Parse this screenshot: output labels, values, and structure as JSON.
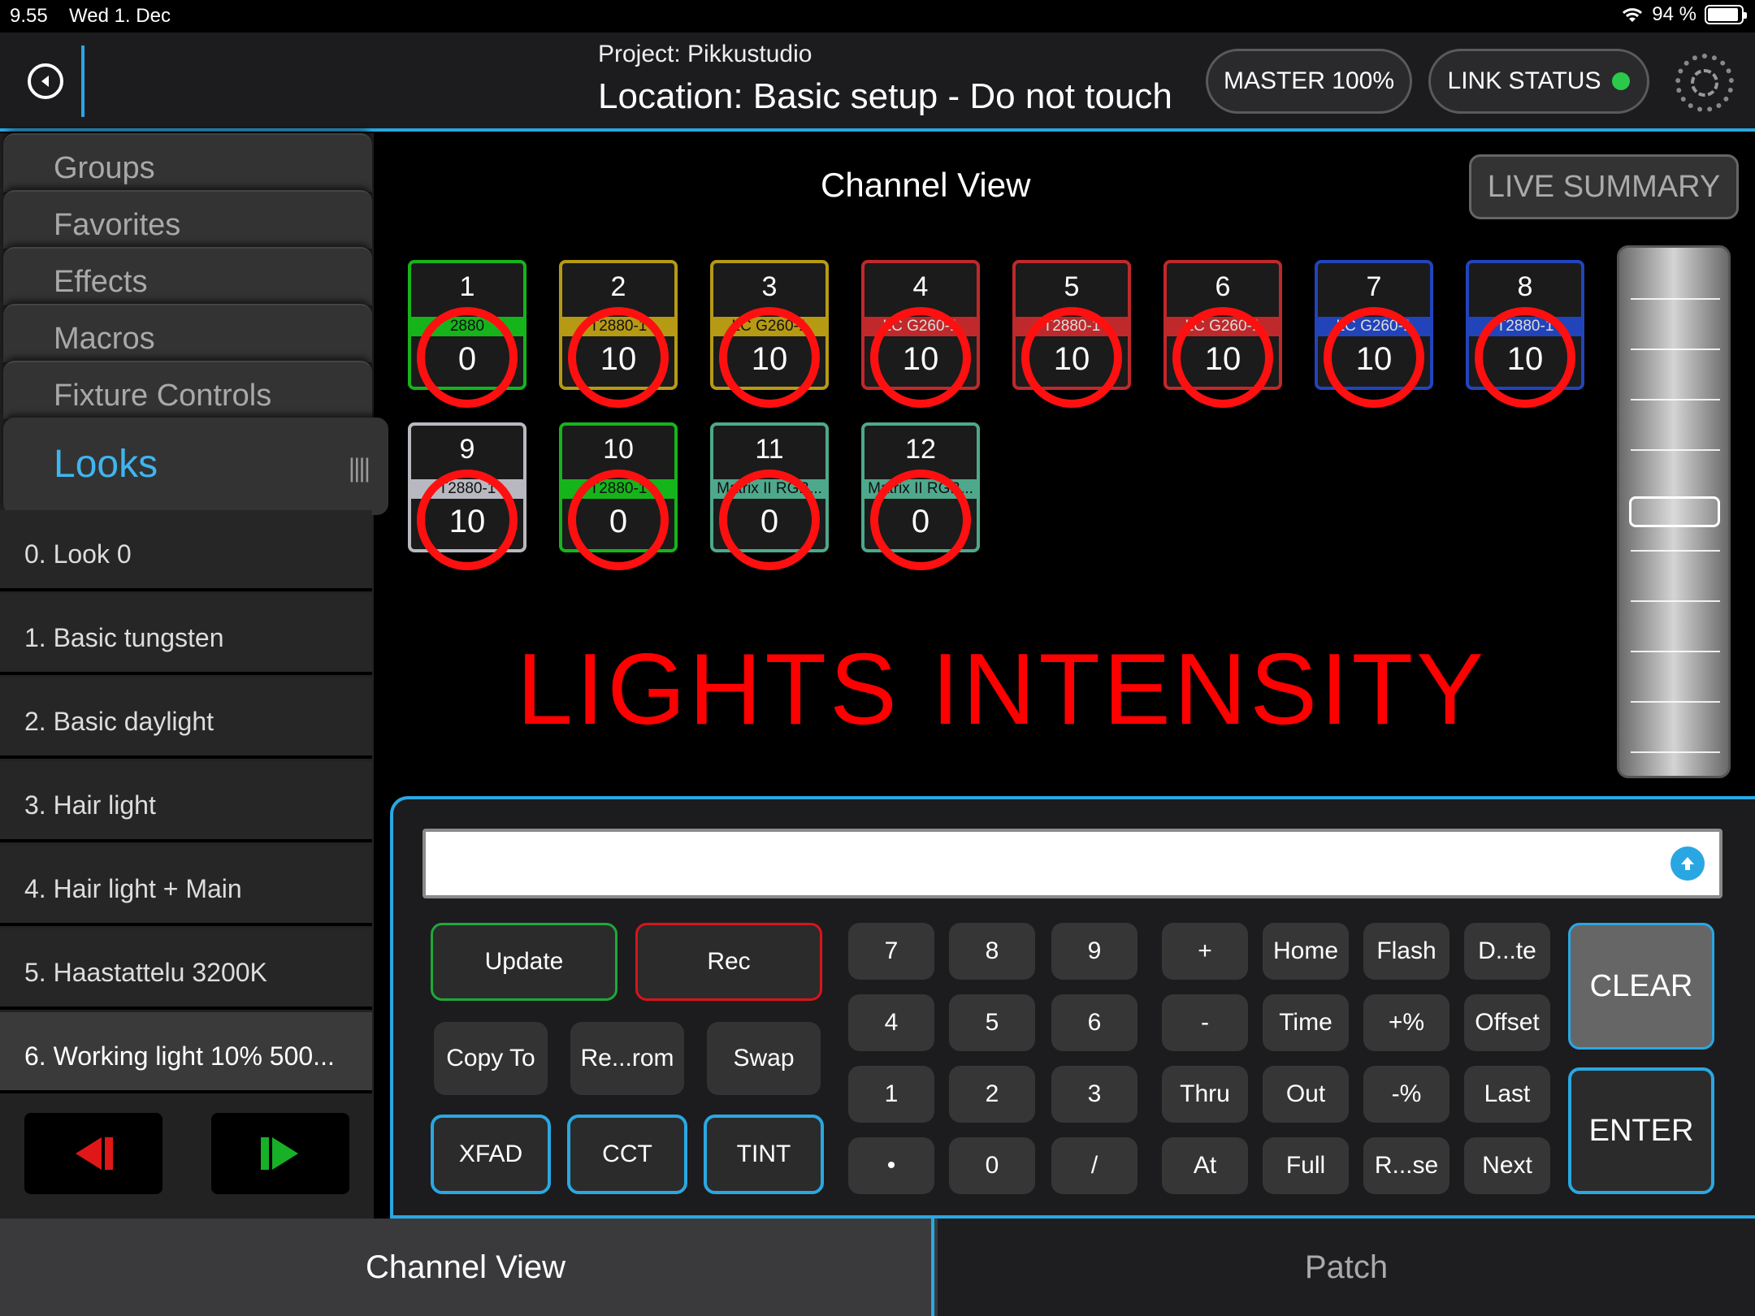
{
  "status": {
    "time": "9.55",
    "date": "Wed 1. Dec",
    "battery": "94 %"
  },
  "header": {
    "project": "Project: Pikkustudio",
    "location": "Location: Basic setup - Do not touch",
    "master": "MASTER 100%",
    "link_status": "LINK STATUS",
    "link_color": "#2bc94b"
  },
  "sidebar": {
    "tabs": [
      "Groups",
      "Favorites",
      "Effects",
      "Macros",
      "Fixture Controls"
    ],
    "active_tab": "Looks",
    "looks": [
      "0. Look 0",
      "1. Basic tungsten",
      "2. Basic daylight",
      "3. Hair light",
      "4. Hair light + Main",
      "5. Haastattelu 3200K",
      "6. Working light 10% 500..."
    ]
  },
  "channel_view": {
    "title": "Channel View",
    "live_summary": "LIVE SUMMARY",
    "annotation": "LIGHTS INTENSITY",
    "channels": [
      {
        "num": "1",
        "label": "2880",
        "value": "0",
        "color": "#16b41b"
      },
      {
        "num": "2",
        "label": "T2880-1",
        "value": "10",
        "color": "#b69a14"
      },
      {
        "num": "3",
        "label": "LC G260-1",
        "value": "10",
        "color": "#b69a14"
      },
      {
        "num": "4",
        "label": "LC G260-1",
        "value": "10",
        "color": "#c0292b"
      },
      {
        "num": "5",
        "label": "T2880-1",
        "value": "10",
        "color": "#c0292b"
      },
      {
        "num": "6",
        "label": "LC G260-1",
        "value": "10",
        "color": "#c0292b"
      },
      {
        "num": "7",
        "label": "LC G260-1",
        "value": "10",
        "color": "#2244bb"
      },
      {
        "num": "8",
        "label": "T2880-1",
        "value": "10",
        "color": "#2244bb"
      },
      {
        "num": "9",
        "label": "T2880-1",
        "value": "10",
        "color": "#b8b8c0"
      },
      {
        "num": "10",
        "label": "T2880-1",
        "value": "0",
        "color": "#16b41b"
      },
      {
        "num": "11",
        "label": "Matrix II RGB...",
        "value": "0",
        "color": "#4ea88c"
      },
      {
        "num": "12",
        "label": "Matrix II RGB...",
        "value": "0",
        "color": "#4ea88c"
      }
    ]
  },
  "command": {
    "input_value": "",
    "update": "Update",
    "rec": "Rec",
    "copy_to": "Copy To",
    "rerom": "Re...rom",
    "swap": "Swap",
    "xfad": "XFAD",
    "cct": "CCT",
    "tint": "TINT",
    "keys": [
      [
        "7",
        "8",
        "9",
        "+",
        "Home",
        "Flash",
        "D...te"
      ],
      [
        "4",
        "5",
        "6",
        "-",
        "Time",
        "+%",
        "Offset"
      ],
      [
        "1",
        "2",
        "3",
        "Thru",
        "Out",
        "-%",
        "Last"
      ],
      [
        "•",
        "0",
        "/",
        "At",
        "Full",
        "R...se",
        "Next"
      ]
    ],
    "clear": "CLEAR",
    "enter": "ENTER"
  },
  "bottom_tabs": {
    "channel_view": "Channel View",
    "patch": "Patch"
  }
}
